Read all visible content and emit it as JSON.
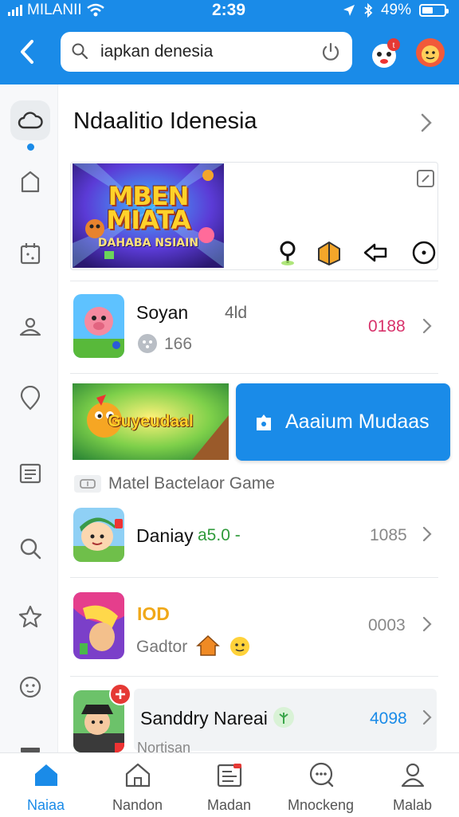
{
  "status_bar": {
    "carrier": "MILANII",
    "time": "2:39",
    "battery": "49%"
  },
  "search": {
    "value": "iapkan denesia"
  },
  "section": {
    "title": "Ndaalitio Idenesia"
  },
  "banner": {
    "title_line1": "MBEN",
    "title_line2": "MIATA",
    "subtitle": "DAHABA NSIAIN"
  },
  "rows": [
    {
      "title": "Soyan",
      "tag": "4ld",
      "sub": "166",
      "count": "0188",
      "count_color": "#d8326b"
    },
    {
      "title": "Daniay",
      "tag": "a5.0 -",
      "count": "1085"
    },
    {
      "title": "IOD",
      "sub": "Gadtor",
      "count": "0003"
    },
    {
      "title": "Sanddry Nareai",
      "sub": "Nortisan",
      "count": "4098",
      "count_color": "#1a8be8"
    }
  ],
  "promo": {
    "image_label": "Guyeudaal",
    "button_label": "Aaaium Mudaas"
  },
  "caption": "Matel Bactelaor Game",
  "nav": [
    {
      "label": "Naiaa",
      "icon": "home-icon",
      "active": true
    },
    {
      "label": "Nandon",
      "icon": "house-icon"
    },
    {
      "label": "Madan",
      "icon": "news-icon"
    },
    {
      "label": "Mnockeng",
      "icon": "chat-icon"
    },
    {
      "label": "Malab",
      "icon": "profile-icon"
    }
  ],
  "colors": {
    "accent": "#1a8be8"
  }
}
